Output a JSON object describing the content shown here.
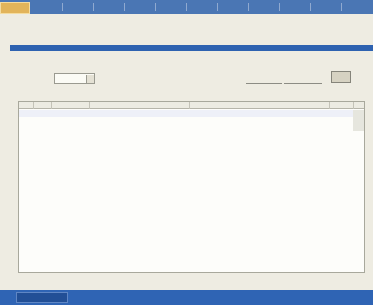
{
  "menu": {
    "active_tab": "",
    "items": [
      "",
      "",
      "",
      "",
      "",
      "",
      "",
      "",
      "",
      ""
    ]
  },
  "section": {
    "title": ""
  },
  "filters": {
    "field_label": "",
    "field_value": "",
    "range_label": "",
    "range_from": "",
    "range_to": "",
    "button_label": ""
  },
  "table": {
    "columns": [
      "",
      "",
      "",
      "",
      "",
      "",
      ""
    ],
    "rows": [
      [
        "",
        "",
        "",
        "",
        "",
        "",
        ""
      ],
      [
        "",
        "",
        "",
        "",
        "",
        "",
        ""
      ],
      [
        "",
        "",
        "",
        "",
        "",
        "",
        ""
      ]
    ]
  },
  "status": {
    "text": ""
  },
  "colors": {
    "menu_bar": "#4a76b4",
    "active_tab": "#e2b45a",
    "section_bar": "#2e62b0",
    "status_bar": "#2f64b4",
    "link_text": "#2a44b0"
  },
  "icons": {
    "spinner": "spinner-icon"
  }
}
